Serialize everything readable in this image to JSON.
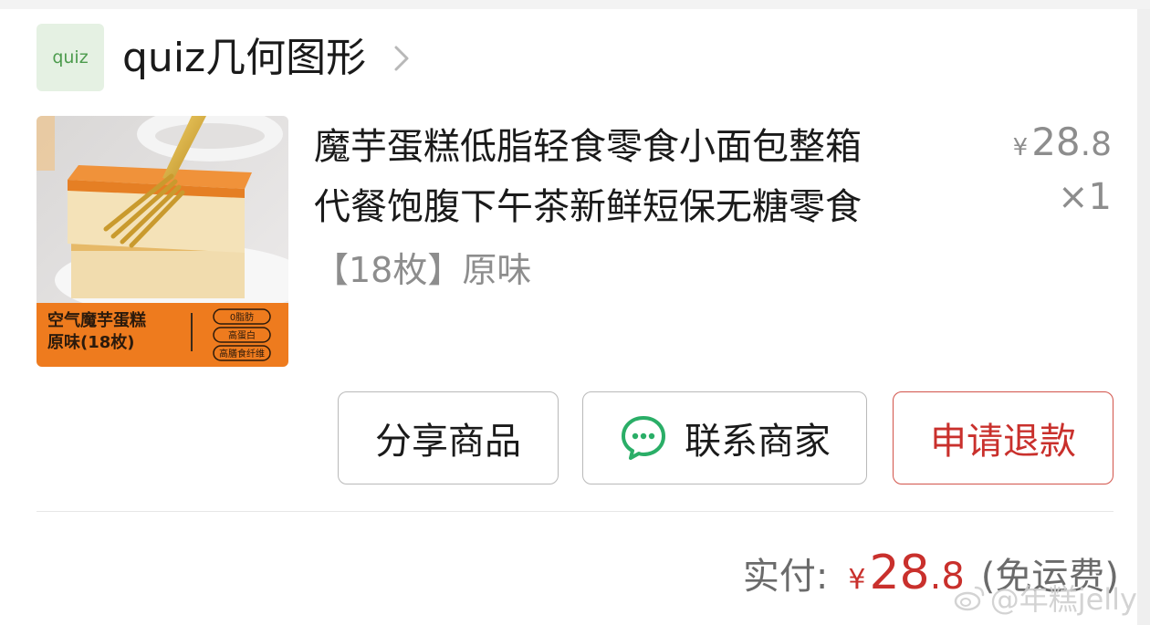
{
  "shop": {
    "logo_text": "quiz",
    "name": "quiz几何图形"
  },
  "product": {
    "image_text": {
      "title_line1": "空气魔芋蛋糕",
      "title_line2": "原味(18枚)",
      "badge1": "0脂肪",
      "badge2": "高蛋白",
      "badge3": "高膳食纤维"
    },
    "title_line1": "魔芋蛋糕低脂轻食零食小面包整箱",
    "title_line2": "代餐饱腹下午茶新鲜短保无糖零食",
    "spec": "【18枚】原味",
    "price_symbol": "¥",
    "price_int": "28",
    "price_dec": ".8",
    "quantity": "×1"
  },
  "actions": {
    "share_label": "分享商品",
    "contact_label": "联系商家",
    "refund_label": "申请退款"
  },
  "total": {
    "label": "实付:",
    "symbol": "¥",
    "int": "28",
    "dec": ".8",
    "note": "(免运费)"
  },
  "watermark": {
    "text": "@年糕jelly"
  },
  "colors": {
    "accent_red": "#c9302c",
    "shop_logo_bg": "#e5f1e3",
    "wechat_green": "#2aae67",
    "image_orange": "#ee7b1e"
  },
  "icons": {
    "shop_chevron": "chevron-right-icon",
    "contact": "chat-bubble-icon",
    "watermark": "weibo-icon"
  }
}
